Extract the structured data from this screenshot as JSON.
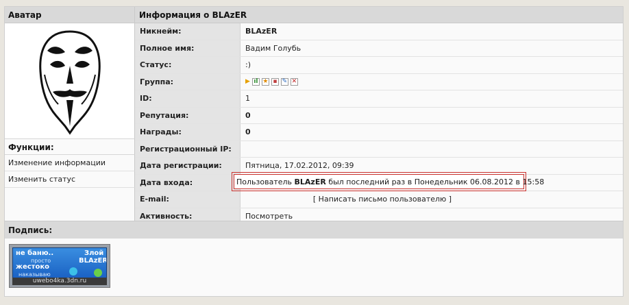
{
  "avatar_header": "Аватар",
  "info_header": "Информация о BLAzER",
  "functions": {
    "title": "Функции:",
    "items": [
      "Изменение информации",
      "Изменить статус"
    ]
  },
  "profile": {
    "nickname": {
      "label": "Никнейм:",
      "value": "BLAzER"
    },
    "fullname": {
      "label": "Полное имя:",
      "value": "Вадим Голубь"
    },
    "status": {
      "label": "Статус:",
      "value": ":)"
    },
    "group": {
      "label": "Группа:",
      "icons": [
        "group-chart-icon",
        "group-star-icon",
        "group-doc-icon",
        "group-edit-icon",
        "group-delete-icon"
      ]
    },
    "id": {
      "label": "ID:",
      "value": "1"
    },
    "reputation": {
      "label": "Репутация:",
      "value": "0"
    },
    "awards": {
      "label": "Награды:",
      "value": "0"
    },
    "reg_ip": {
      "label": "Регистрационный IP:",
      "value": ""
    },
    "reg_date": {
      "label": "Дата регистрации:",
      "value": "Пятница, 17.02.2012, 09:39"
    },
    "login_date": {
      "label": "Дата входа:",
      "prefix": "Пользователь",
      "name": "BLAzER",
      "suffix": "был последний раз в Понедельник 06.08.2012 в 15:58"
    },
    "email": {
      "label": "E-mail:",
      "value": "[ Написать письмо пользователю ]"
    },
    "activity": {
      "label": "Активность:",
      "value": "Посмотреть"
    }
  },
  "signature": {
    "title": "Подпись:",
    "banner": {
      "line1": "не баню..",
      "line2": "просто",
      "line3": "жестоко",
      "line4": "наказываю",
      "right1": "Злой",
      "right2": "BLAzER",
      "footer": "uwebo4ka.3dn.ru"
    }
  },
  "colors": {
    "highlight": "#c9302c",
    "header_bg": "#d9d9d9",
    "label_bg": "#e4e4e4"
  }
}
